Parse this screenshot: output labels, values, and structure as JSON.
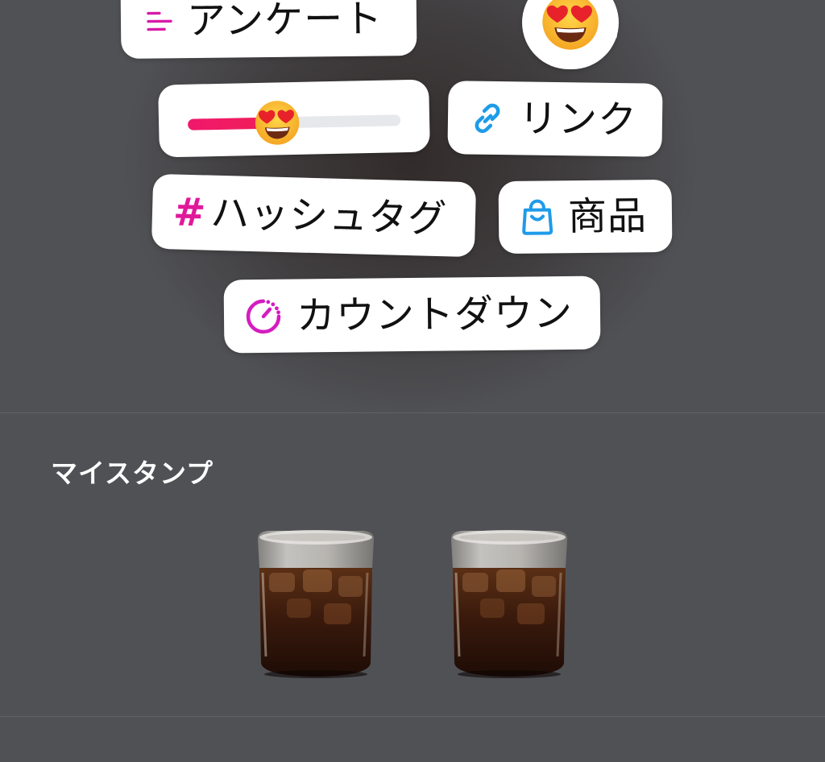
{
  "stickers": {
    "poll": {
      "label": "アンケート",
      "icon": "poll-lines-icon"
    },
    "emoji_question": {
      "icon": "heart-eyes-emoji-icon"
    },
    "emoji_slider": {
      "icon": "heart-eyes-emoji-icon",
      "value": 0.42
    },
    "link": {
      "label": "リンク",
      "icon": "link-icon"
    },
    "hashtag": {
      "label": "ハッシュタグ",
      "prefix": "#",
      "icon": "hash-icon"
    },
    "product": {
      "label": "商品",
      "icon": "shopping-bag-icon"
    },
    "countdown": {
      "label": "カウントダウン",
      "icon": "countdown-timer-icon"
    }
  },
  "my_stamps": {
    "title": "マイスタンプ",
    "items": [
      {
        "icon": "iced-coffee-glass-sticker"
      },
      {
        "icon": "iced-coffee-glass-sticker"
      }
    ]
  },
  "colors": {
    "background": "#505155",
    "sticker": "#ffffff",
    "accent_magenta": "#e0199a",
    "accent_blue": "#1e9be9",
    "slider_fill": "#ef1f5e"
  }
}
